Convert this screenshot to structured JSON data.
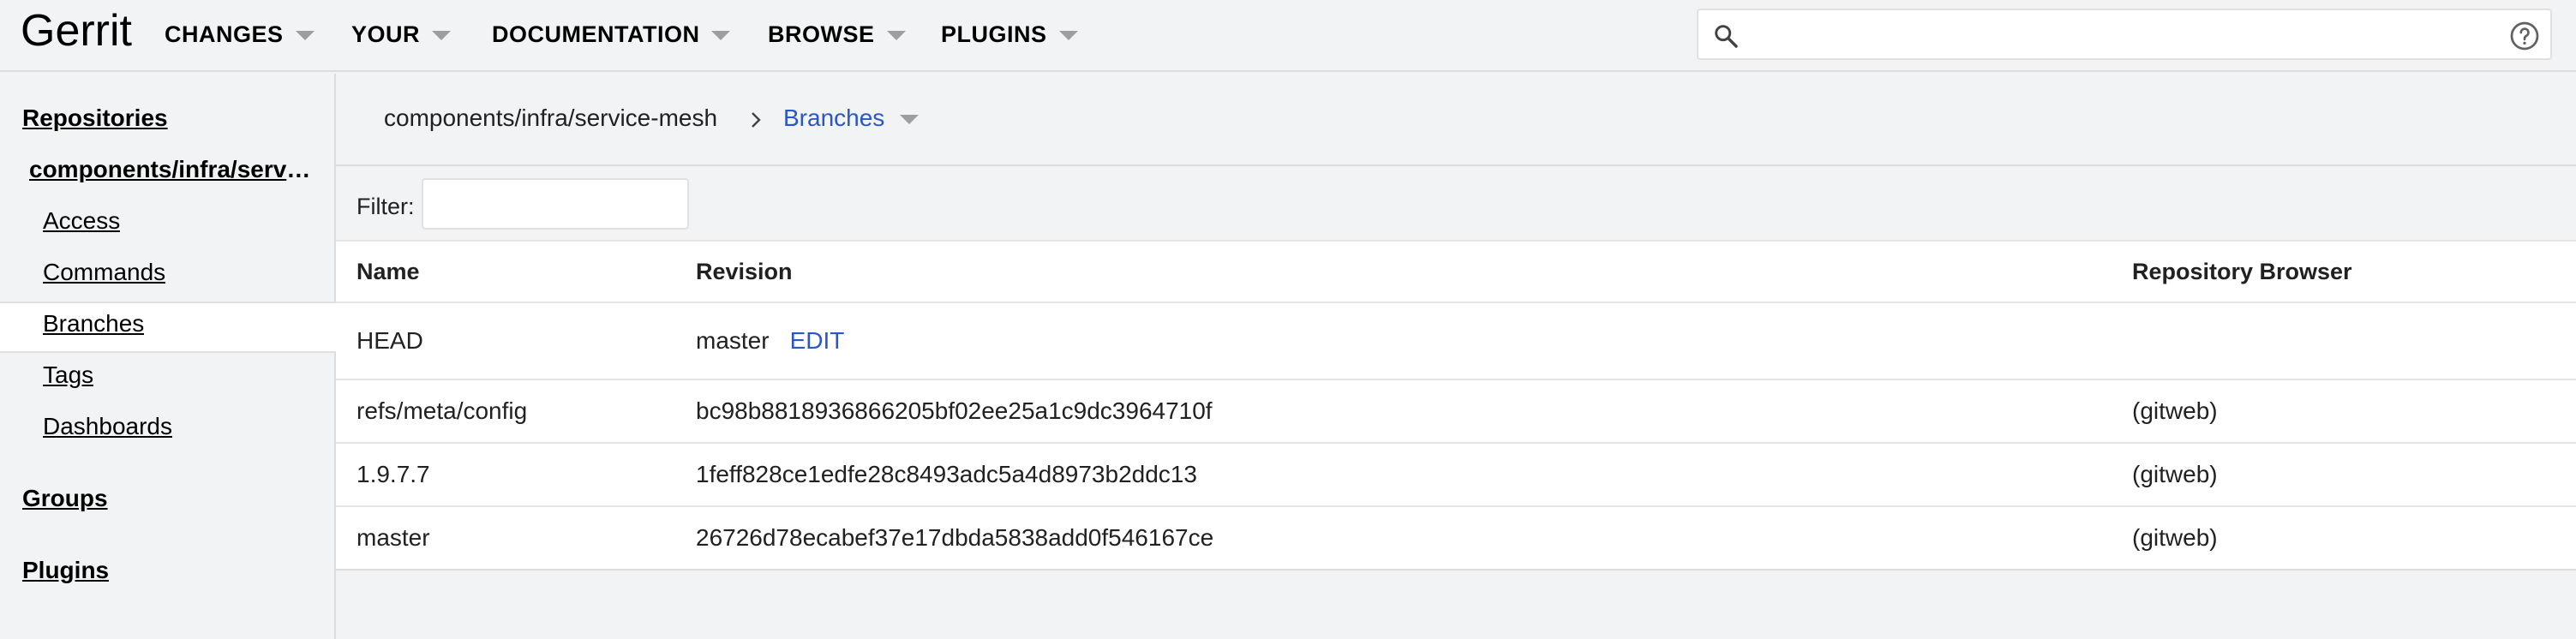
{
  "header": {
    "logo": "Gerrit",
    "nav": [
      {
        "label": "CHANGES"
      },
      {
        "label": "YOUR"
      },
      {
        "label": "DOCUMENTATION"
      },
      {
        "label": "BROWSE"
      },
      {
        "label": "PLUGINS"
      }
    ],
    "search": {
      "value": "",
      "placeholder": ""
    },
    "icons": {
      "search": "search-icon",
      "help": "help-icon"
    }
  },
  "sidebar": {
    "repositories": "Repositories",
    "repo_name": "components/infra/servi...",
    "items": [
      {
        "label": "Access"
      },
      {
        "label": "Commands"
      },
      {
        "label": "Branches"
      },
      {
        "label": "Tags"
      },
      {
        "label": "Dashboards"
      }
    ],
    "selected": "Branches",
    "groups": "Groups",
    "plugins": "Plugins"
  },
  "breadcrumb": {
    "repo": "components/infra/service-mesh",
    "current": "Branches"
  },
  "filter": {
    "label": "Filter:",
    "value": ""
  },
  "table": {
    "headers": {
      "name": "Name",
      "revision": "Revision",
      "browser": "Repository Browser"
    },
    "rows": [
      {
        "name": "HEAD",
        "revision": "master",
        "action": "EDIT",
        "browser": ""
      },
      {
        "name": "refs/meta/config",
        "revision": "bc98b8818936866205bf02ee25a1c9dc3964710f",
        "browser": "(gitweb)"
      },
      {
        "name": "1.9.7.7",
        "revision": "1feff828ce1edfe28c8493adc5a4d8973b2ddc13",
        "browser": "(gitweb)"
      },
      {
        "name": "master",
        "revision": "26726d78ecabef37e17dbda5838add0f546167ce",
        "browser": "(gitweb)"
      }
    ]
  },
  "colors": {
    "link": "#2a56c6",
    "background": "#f1f3f4",
    "surface": "#ffffff"
  }
}
